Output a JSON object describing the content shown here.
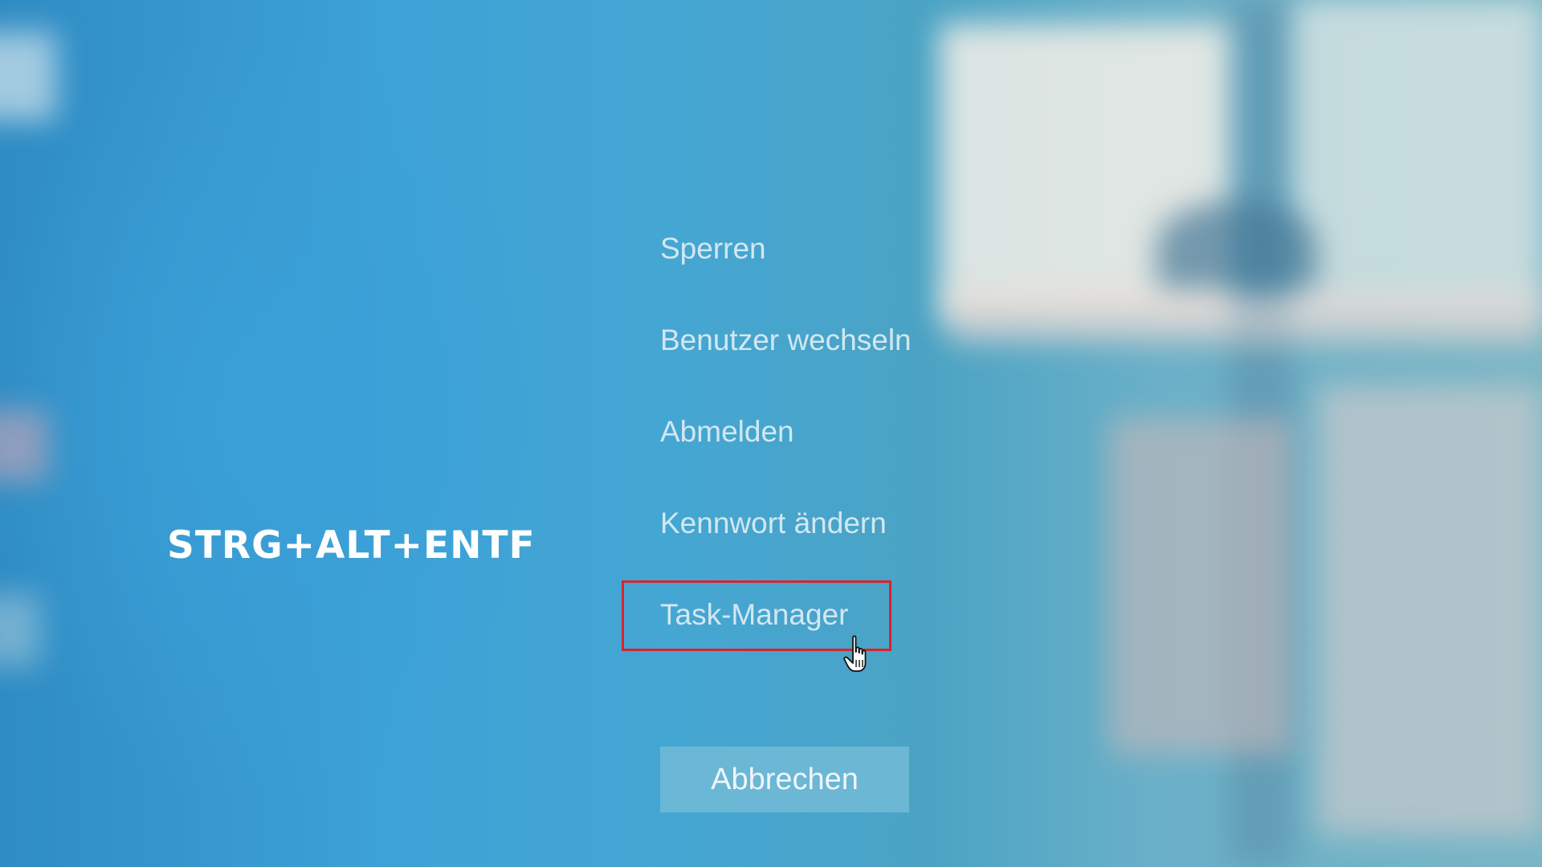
{
  "overlay": {
    "shortcut_label": "STRG+ALT+ENTF"
  },
  "menu": {
    "items": [
      {
        "id": "sperren",
        "label": "Sperren"
      },
      {
        "id": "benutzer-wechseln",
        "label": "Benutzer wechseln"
      },
      {
        "id": "abmelden",
        "label": "Abmelden"
      },
      {
        "id": "kennwort-aendern",
        "label": "Kennwort ändern"
      },
      {
        "id": "task-manager",
        "label": "Task-Manager",
        "highlighted": true
      }
    ]
  },
  "cancel_button": {
    "label": "Abbrechen"
  },
  "colors": {
    "background": "#3a9ccb",
    "highlight_border": "#d9232d",
    "menu_text": "#e6f1f7",
    "button_bg": "#78bed7"
  },
  "icons": {
    "cursor": "hand-pointer-icon"
  }
}
